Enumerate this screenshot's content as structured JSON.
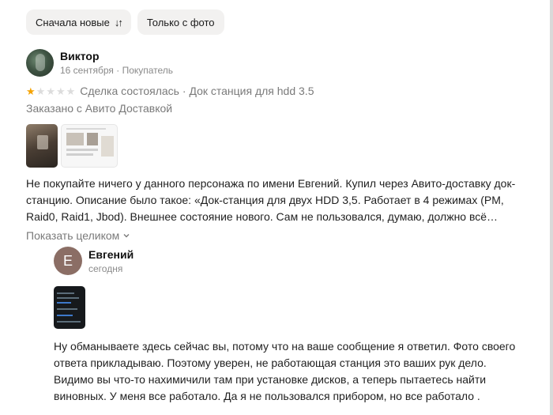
{
  "filters": {
    "sort_label": "Сначала новые",
    "sort_icon": "sort-icon",
    "photo_only_label": "Только с фото"
  },
  "review": {
    "author_name": "Виктор",
    "date": "16 сентября",
    "role": "Покупатель",
    "rating": 1,
    "max_rating": 5,
    "deal_status": "Сделка состоялась",
    "product": "Док станция для hdd 3.5",
    "delivery_note": "Заказано с Авито Доставкой",
    "text": "Не покупайте ничего у данного персонажа по имени Евгений. Купил через Авито-доставку док-станцию. Описание было такое: «Док-станция для двух HDD 3,5. Работает в 4 режимах (PM, Raid0, Raid1, Jbod). Внешнее состояние нового. Сам не пользовался, думаю, должно всё…",
    "show_more_label": "Показать целиком"
  },
  "reply": {
    "author_initial": "Е",
    "author_name": "Евгений",
    "date": "сегодня",
    "text": "Ну обманываете здесь сейчас вы, потому что на ваше сообщение я ответил. Фото своего ответа прикладываю. Поэтому уверен, не работающая станция это ваших рук дело. Видимо вы что-то нахимичили там при установке дисков, а теперь пытаетесь найти виновных. У меня все работало. Да я не пользовался прибором, но все работало ."
  },
  "colors": {
    "star_active": "#f5a300",
    "star_inactive": "#dcdcdc",
    "chip_bg": "#f2f1f0",
    "reply_avatar_bg": "#8b6e65"
  }
}
